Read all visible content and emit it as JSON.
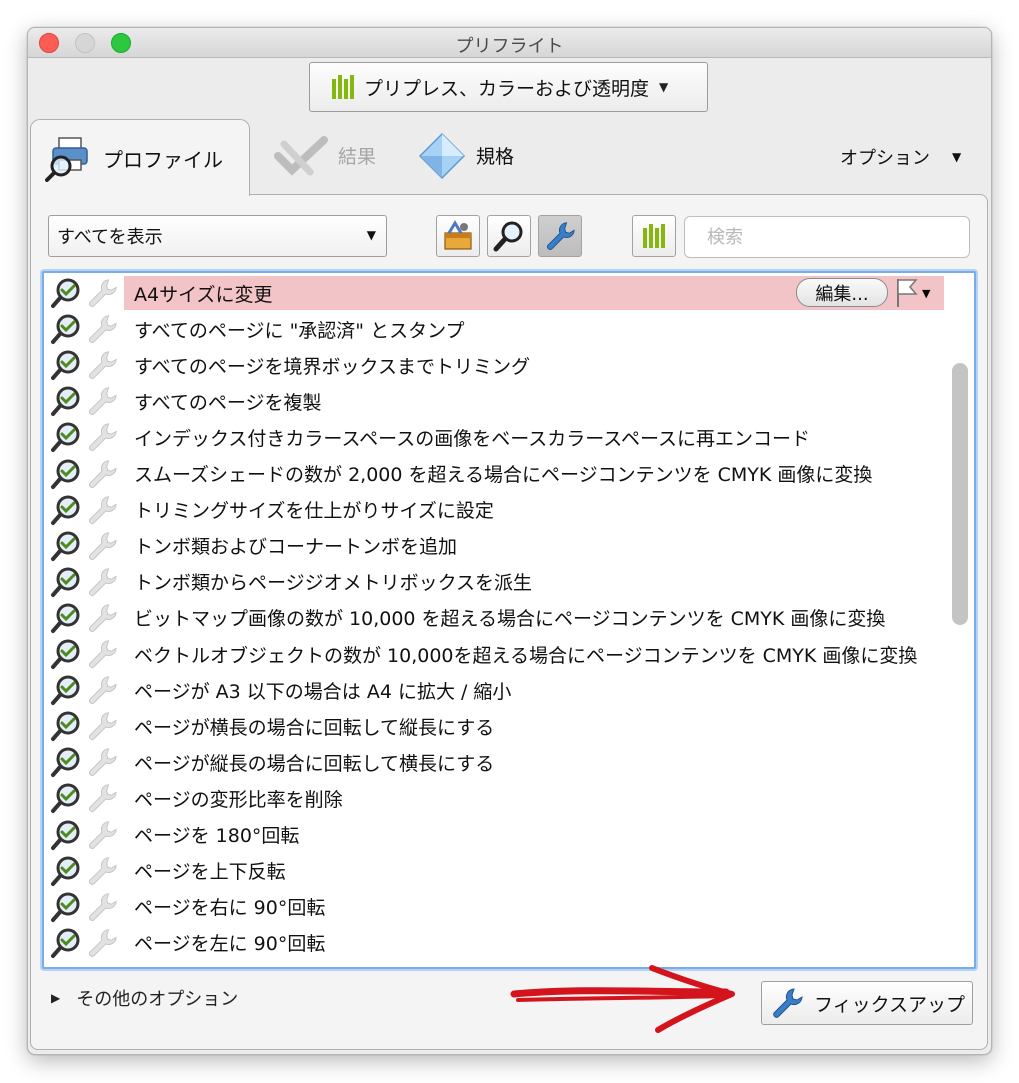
{
  "window": {
    "title": "プリフライト"
  },
  "profile_selector": {
    "label": "プリプレス、カラーおよび透明度",
    "icon": "green-bars-icon"
  },
  "tabs": [
    {
      "label": "プロファイル",
      "icon": "profile-printer-magnifier-icon",
      "active": true
    },
    {
      "label": "結果",
      "icon": "results-check-icon",
      "active": false
    },
    {
      "label": "規格",
      "icon": "standards-diamond-icon",
      "active": false
    }
  ],
  "options_menu": {
    "label": "オプション"
  },
  "filter": {
    "selected": "すべてを表示"
  },
  "toolbar_buttons": [
    {
      "name": "toolbox-button",
      "icon": "toolbox-icon"
    },
    {
      "name": "check-button",
      "icon": "magnifier-icon"
    },
    {
      "name": "fixup-filter-button",
      "icon": "wrench-icon",
      "pressed": true
    },
    {
      "name": "profiles-button",
      "icon": "green-bars-icon"
    }
  ],
  "search": {
    "placeholder": "検索",
    "value": ""
  },
  "fixups": [
    "A4サイズに変更",
    "すべてのページに \"承認済\" とスタンプ",
    "すべてのページを境界ボックスまでトリミング",
    "すべてのページを複製",
    "インデックス付きカラースペースの画像をベースカラースペースに再エンコード",
    "スムーズシェードの数が 2,000 を超える場合にページコンテンツを CMYK 画像に変換",
    "トリミングサイズを仕上がりサイズに設定",
    "トンボ類およびコーナートンボを追加",
    "トンボ類からページジオメトリボックスを派生",
    "ビットマップ画像の数が 10,000 を超える場合にページコンテンツを CMYK 画像に変換",
    "ベクトルオブジェクトの数が 10,000を超える場合にページコンテンツを CMYK 画像に変換",
    "ページが A3 以下の場合は A4 に拡大 / 縮小",
    "ページが横長の場合に回転して縦長にする",
    "ページが縦長の場合に回転して横長にする",
    "ページの変形比率を削除",
    "ページを 180°回転",
    "ページを上下反転",
    "ページを右に 90°回転",
    "ページを左に 90°回転"
  ],
  "selected_row": {
    "index": 0,
    "edit_label": "編集...",
    "flag_icon": "flag-icon",
    "highlight_color": "#f2c3c7"
  },
  "more_options": {
    "label": "その他のオプション"
  },
  "fixup_button": {
    "label": "フィックスアップ",
    "icon": "wrench-icon"
  },
  "colors": {
    "accent_blue": "#7aacea",
    "green": "#86b70e",
    "annotation_red": "#d4141c"
  }
}
